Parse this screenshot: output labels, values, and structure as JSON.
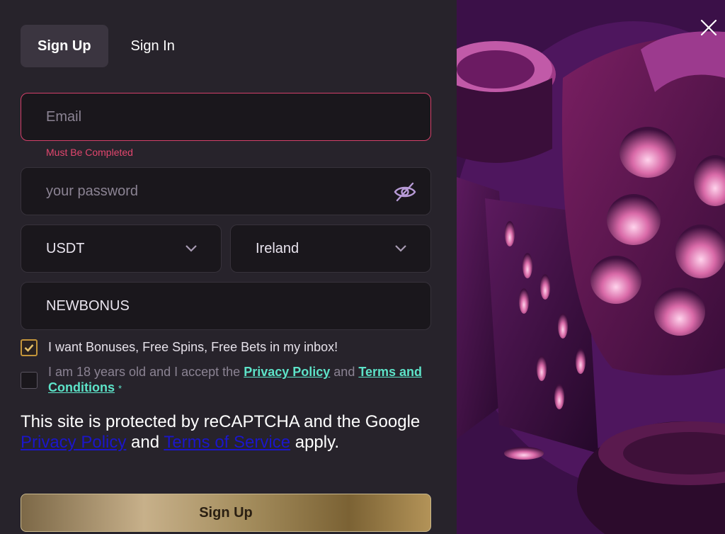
{
  "tabs": {
    "sign_up": "Sign Up",
    "sign_in": "Sign In"
  },
  "email": {
    "placeholder": "Email",
    "error": "Must Be Completed"
  },
  "password": {
    "placeholder": "your password"
  },
  "currency": {
    "value": "USDT"
  },
  "country": {
    "value": "Ireland"
  },
  "promo": {
    "value": "NEWBONUS"
  },
  "bonuses_checkbox": {
    "label": "I want Bonuses, Free Spins, Free Bets in my inbox!",
    "checked": true
  },
  "terms_checkbox": {
    "text_before": "I am 18 years old and I accept the",
    "privacy_link": "Privacy Policy",
    "and_text": "and",
    "terms_link": "Terms and Conditions",
    "required_mark": "*",
    "checked": false
  },
  "recaptcha": {
    "text_before": "This site is protected by reCAPTCHA and the Google",
    "privacy_link": "Privacy Policy",
    "and_text": "and",
    "terms_link": "Terms of Service",
    "text_after": "apply."
  },
  "submit": {
    "label": "Sign Up"
  },
  "colors": {
    "accent_teal": "#5de3c8",
    "error": "#e2466e",
    "gold": "#c4953a",
    "panel": "#27232b"
  },
  "icons": [
    "close-icon",
    "eye-slash-icon",
    "chevron-down-icon",
    "checkmark-icon"
  ]
}
